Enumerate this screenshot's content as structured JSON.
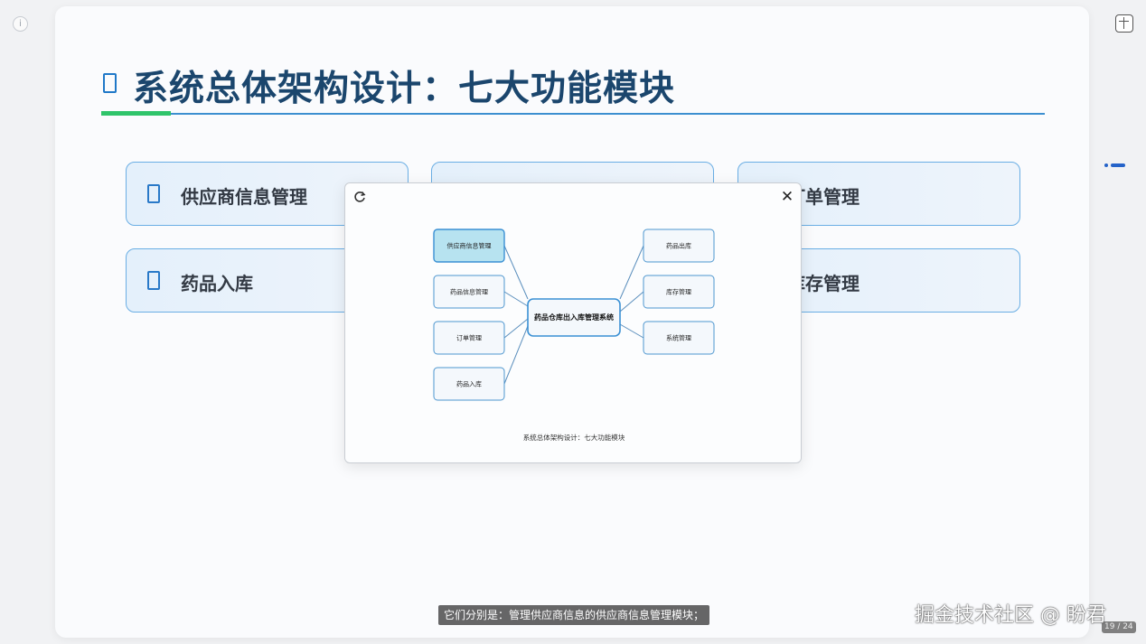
{
  "slide": {
    "title": "系统总体架构设计：七大功能模块",
    "cards": [
      {
        "label": "供应商信息管理"
      },
      {
        "label": ""
      },
      {
        "label": "订单管理"
      },
      {
        "label": "药品入库"
      },
      {
        "label": "库存管理"
      }
    ]
  },
  "modal": {
    "diagram": {
      "center": "药品仓库出入库管理系统",
      "left_nodes": [
        "供应商信息管理",
        "药品信息管理",
        "订单管理",
        "药品入库"
      ],
      "right_nodes": [
        "药品出库",
        "库存管理",
        "系统管理"
      ],
      "highlighted": "供应商信息管理"
    },
    "caption": "系统总体架构设计：七大功能模块"
  },
  "subtitle": "它们分别是：管理供应商信息的供应商信息管理模块；",
  "watermark": "掘金技术社区 @ 盼君",
  "page_counter": "19 / 24",
  "colors": {
    "title": "#1b466d",
    "accent_green": "#2fc46a",
    "accent_blue": "#3c8fd0",
    "card_border": "#6aaee4",
    "highlight_fill": "#b7e3f0"
  }
}
